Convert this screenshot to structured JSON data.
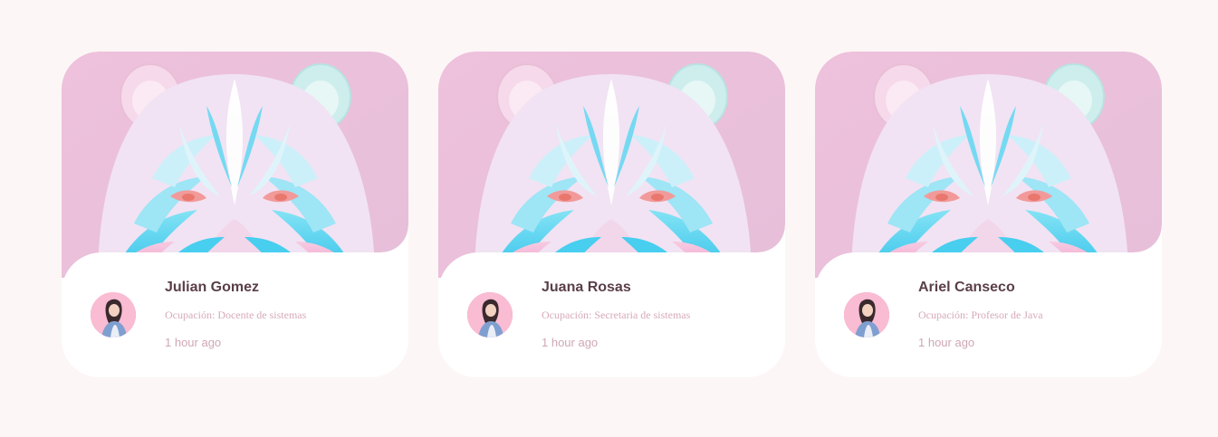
{
  "colors": {
    "page_background": "#fdf6f6",
    "card_background": "#ffffff",
    "name_color": "#5a3f4a",
    "meta_color": "#d6aab9",
    "image_background": "#ebc0dc"
  },
  "cards": [
    {
      "image": "pastel-paper-bear-illustration",
      "avatar": "woman-portrait-avatar",
      "name": "Julian Gomez",
      "occupation": "Ocupación: Docente de sistemas",
      "time": "1 hour ago"
    },
    {
      "image": "pastel-paper-bear-illustration",
      "avatar": "woman-portrait-avatar",
      "name": "Juana Rosas",
      "occupation": "Ocupación: Secretaria de sistemas",
      "time": "1 hour ago"
    },
    {
      "image": "pastel-paper-bear-illustration",
      "avatar": "woman-portrait-avatar",
      "name": "Ariel Canseco",
      "occupation": "Ocupación: Profesor de Java",
      "time": "1 hour ago"
    }
  ]
}
